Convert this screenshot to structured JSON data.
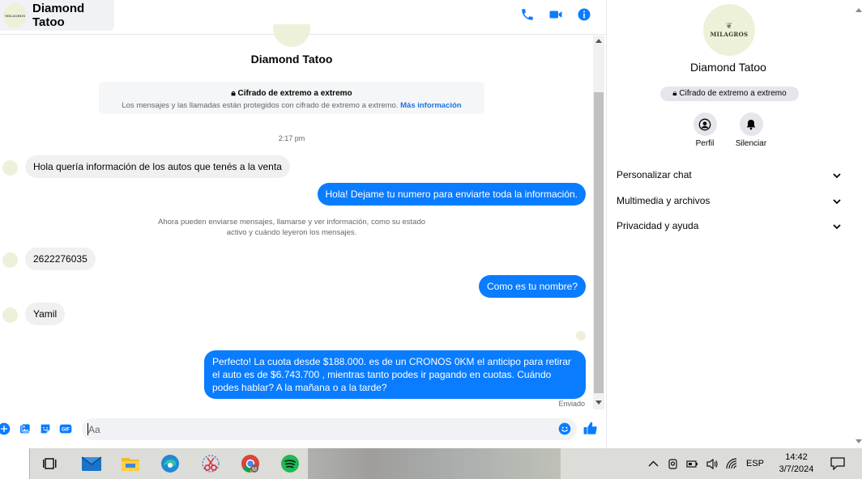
{
  "header": {
    "contact_name": "Diamond Tatoo",
    "avatar_text": "MILAGROS"
  },
  "chat": {
    "contact_title": "Diamond Tatoo",
    "e2e_title": "Cifrado de extremo a extremo",
    "e2e_desc": "Los mensajes y las llamadas están protegidos con cifrado de extremo a extremo.",
    "e2e_link": "Más información",
    "timestamp": "2:17 pm",
    "messages": [
      {
        "from": "them",
        "text": "Hola quería información de los autos que tenés a la venta"
      },
      {
        "from": "me",
        "text": "Hola! Dejame tu numero  para enviarte toda la información."
      },
      {
        "from": "them",
        "text": "2622276035"
      },
      {
        "from": "me",
        "text": "Como es tu nombre?"
      },
      {
        "from": "them",
        "text": "Yamil"
      },
      {
        "from": "me",
        "text": "Perfecto! La cuota desde $188.000. es de un CRONOS 0KM el anticipo para retirar el auto es de $6.743.700 , mientras tanto podes ir pagando en cuotas. Cuándo podes hablar? A la mañana o a la tarde?"
      }
    ],
    "system_line1": "Ahora pueden enviarse mensajes, llamarse y ver información, como su estado",
    "system_line2": "activo y cuándo leyeron los mensajes.",
    "sent_status": "Enviado"
  },
  "composer": {
    "placeholder": "Aa"
  },
  "info_panel": {
    "avatar_text": "MILAGROS",
    "name": "Diamond Tatoo",
    "e2e_label": "Cifrado de extremo a extremo",
    "actions": [
      {
        "label": "Perfil"
      },
      {
        "label": "Silenciar"
      }
    ],
    "sections": [
      {
        "label": "Personalizar chat"
      },
      {
        "label": "Multimedia y archivos"
      },
      {
        "label": "Privacidad y ayuda"
      }
    ]
  },
  "taskbar": {
    "language": "ESP",
    "time": "14:42",
    "date": "3/7/2024",
    "apps": [
      "task-view",
      "mail",
      "file-explorer",
      "edge",
      "snipping-tool",
      "chrome",
      "spotify"
    ]
  },
  "colors": {
    "accent": "#0a7cff",
    "messenger_blue": "#0084ff",
    "incoming_bubble": "#f0f0f0",
    "muted_text": "#65676b"
  }
}
